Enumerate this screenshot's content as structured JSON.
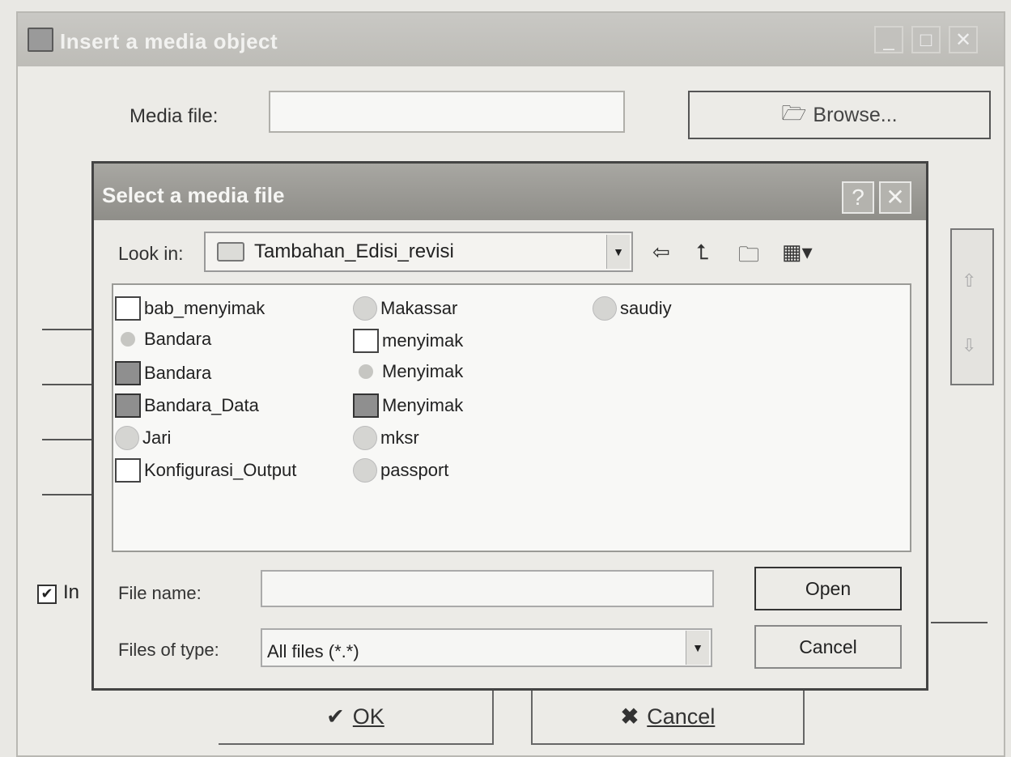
{
  "outer_dialog": {
    "title": "Insert a media object",
    "media_file_label": "Media file:",
    "media_file_value": "",
    "browse_label": "Browse...",
    "include_label": "In",
    "include_checked": true,
    "ok_label": "OK",
    "cancel_label": "Cancel"
  },
  "select_dialog": {
    "title": "Select a media file",
    "help_symbol": "?",
    "look_in_label": "Look in:",
    "look_in_value": "Tambahan_Edisi_revisi",
    "files": [
      {
        "name": "bab_menyimak",
        "icon": "document-icon"
      },
      {
        "name": "Bandara",
        "icon": "audio-icon"
      },
      {
        "name": "Bandara",
        "icon": "video-icon"
      },
      {
        "name": "Bandara_Data",
        "icon": "video-icon"
      },
      {
        "name": "Jari",
        "icon": "media-globe-icon"
      },
      {
        "name": "Konfigurasi_Output",
        "icon": "document-icon"
      },
      {
        "name": "Makassar",
        "icon": "media-globe-icon"
      },
      {
        "name": "menyimak",
        "icon": "document-icon"
      },
      {
        "name": "Menyimak",
        "icon": "audio-icon"
      },
      {
        "name": "Menyimak",
        "icon": "video-icon"
      },
      {
        "name": "mksr",
        "icon": "media-globe-icon"
      },
      {
        "name": "passport",
        "icon": "media-globe-icon"
      },
      {
        "name": "saudiy",
        "icon": "media-globe-icon"
      }
    ],
    "file_name_label": "File name:",
    "file_name_value": "",
    "files_of_type_label": "Files of type:",
    "files_of_type_value": "All files (*.*)",
    "open_label": "Open",
    "cancel_label": "Cancel"
  }
}
